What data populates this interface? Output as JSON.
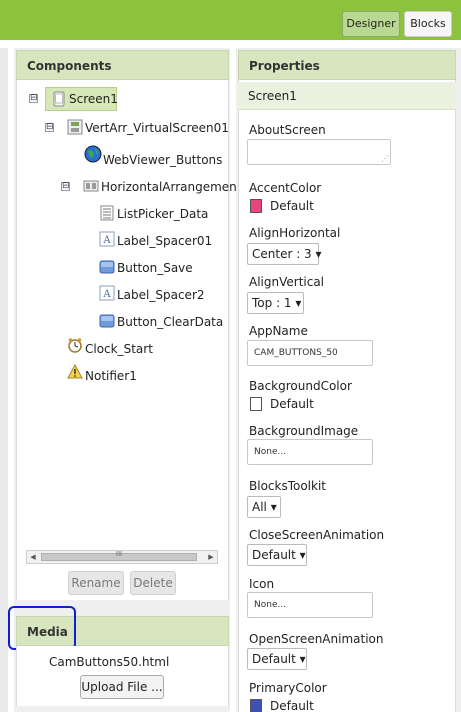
{
  "topbar": {
    "designer_label": "Designer",
    "blocks_label": "Blocks"
  },
  "components": {
    "title": "Components",
    "tree": [
      {
        "label": "Screen1",
        "icon": "screen-icon",
        "toggle": "⊟",
        "selected": true
      },
      {
        "label": "VertArr_VirtualScreen01",
        "icon": "vertical-arrangement-icon",
        "toggle": "⊟"
      },
      {
        "label": "WebViewer_Buttons",
        "icon": "webviewer-globe-icon"
      },
      {
        "label": "HorizontalArrangemen",
        "icon": "horizontal-arrangement-icon",
        "toggle": "⊟"
      },
      {
        "label": "ListPicker_Data",
        "icon": "listpicker-icon"
      },
      {
        "label": "Label_Spacer01",
        "icon": "label-icon"
      },
      {
        "label": "Button_Save",
        "icon": "button-icon"
      },
      {
        "label": "Label_Spacer2",
        "icon": "label-icon"
      },
      {
        "label": "Button_ClearData",
        "icon": "button-icon"
      },
      {
        "label": "Clock_Start",
        "icon": "clock-icon"
      },
      {
        "label": "Notifier1",
        "icon": "notifier-warning-icon"
      }
    ],
    "scroll_thumb": "III",
    "rename_label": "Rename",
    "delete_label": "Delete"
  },
  "media": {
    "title": "Media",
    "file": "CamButtons50.html",
    "upload_label": "Upload File ..."
  },
  "properties": {
    "title": "Properties",
    "component": "Screen1",
    "about_screen": {
      "label": "AboutScreen",
      "value": ""
    },
    "accent_color": {
      "label": "AccentColor",
      "value": "Default",
      "color": "#e8467c"
    },
    "align_horizontal": {
      "label": "AlignHorizontal",
      "value": "Center : 3 ▾"
    },
    "align_vertical": {
      "label": "AlignVertical",
      "value": "Top : 1 ▾"
    },
    "app_name": {
      "label": "AppName",
      "value": "CAM_BUTTONS_50"
    },
    "background_color": {
      "label": "BackgroundColor",
      "value": "Default",
      "color": "#ffffff"
    },
    "background_image": {
      "label": "BackgroundImage",
      "value": "None..."
    },
    "blocks_toolkit": {
      "label": "BlocksToolkit",
      "value": "All ▾"
    },
    "close_screen_animation": {
      "label": "CloseScreenAnimation",
      "value": "Default ▾"
    },
    "icon": {
      "label": "Icon",
      "value": "None..."
    },
    "open_screen_animation": {
      "label": "OpenScreenAnimation",
      "value": "Default ▾"
    },
    "primary_color": {
      "label": "PrimaryColor",
      "value": "Default",
      "color": "#3f51b5"
    }
  }
}
